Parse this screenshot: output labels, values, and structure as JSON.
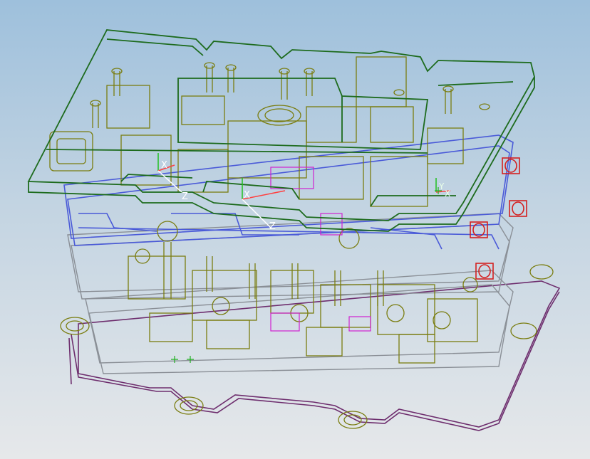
{
  "viewport": {
    "background_top": "#9ec0dc",
    "background_bottom": "#e6e8ea"
  },
  "colors": {
    "top_plate": "#1d6b1d",
    "olive_components": "#7a7d10",
    "blue_plates": "#4a5ad8",
    "gray_plates": "#8a8f96",
    "bottom_plate": "#6e2e6e",
    "red_connectors": "#d42020",
    "magenta_parts": "#d020d0"
  },
  "axis_triads": [
    {
      "x": "X",
      "y": "Y",
      "z": "Z"
    },
    {
      "x": "X",
      "y": "Y",
      "z": "Z"
    },
    {
      "x": "X",
      "y": "Y",
      "z": "Z"
    }
  ],
  "labels": {
    "triad_a_x": "X",
    "triad_a_z": "Z",
    "triad_b_x": "X",
    "triad_b_z": "Z",
    "triad_c_y": "Y",
    "triad_c_x": "X"
  }
}
